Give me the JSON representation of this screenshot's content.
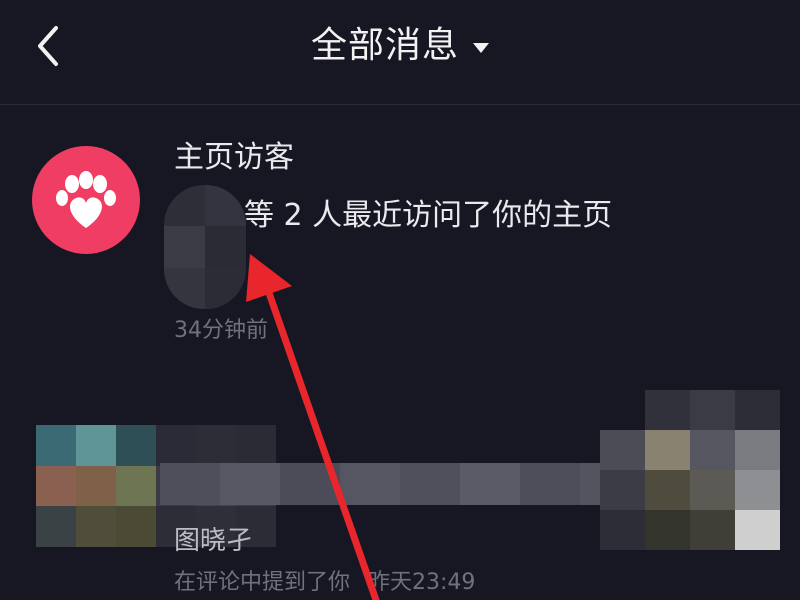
{
  "header": {
    "title": "全部消息",
    "back_icon": "chevron-left-icon",
    "dropdown_icon": "caret-down-icon"
  },
  "notifications": [
    {
      "type": "visitors",
      "icon": "paw-heart-icon",
      "icon_bg": "#ef3d63",
      "title": "主页访客",
      "body": "等 2 人最近访问了你的主页",
      "time": "34分钟前"
    },
    {
      "type": "mention",
      "name": "图晓孑",
      "action": "在评论中提到了你",
      "time": "昨天23:49"
    }
  ],
  "colors": {
    "background": "#161722",
    "accent_pink": "#ef3d63",
    "annotation_arrow": "#e8262c"
  }
}
